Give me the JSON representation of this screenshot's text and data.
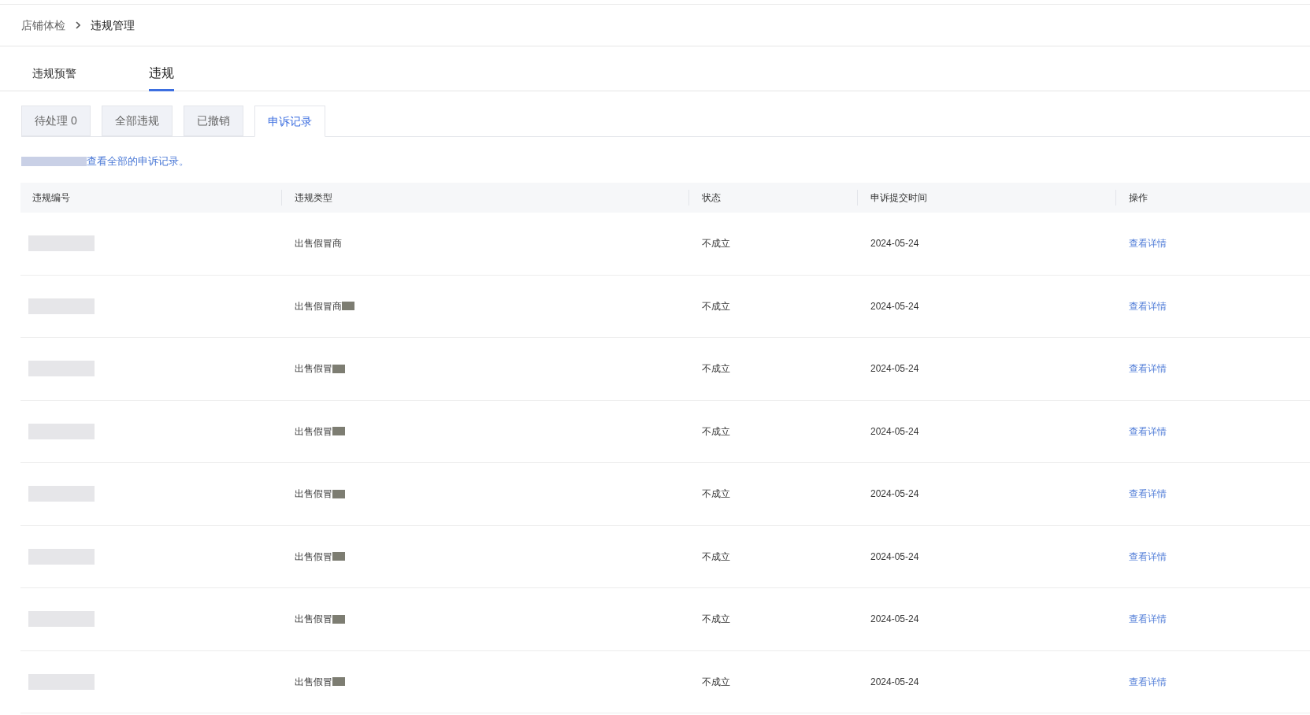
{
  "breadcrumb": [
    {
      "label": "店铺体检",
      "current": false
    },
    {
      "label": "违规管理",
      "current": true
    }
  ],
  "tabs": [
    {
      "label": "违规预警",
      "selected": false
    },
    {
      "label": "违规",
      "selected": true
    }
  ],
  "sub_tabs": [
    {
      "label": "待处理 0",
      "selected": false
    },
    {
      "label": "全部违规",
      "selected": false
    },
    {
      "label": "已撤销",
      "selected": false
    },
    {
      "label": "申诉记录",
      "selected": true
    }
  ],
  "notice": {
    "prefix_blurred": true,
    "text": "查看全部的申诉记录。"
  },
  "table": {
    "columns": [
      "违规编号",
      "违规类型",
      "状态",
      "申诉提交时间",
      "操作"
    ],
    "rows": [
      {
        "id_blurred": true,
        "type": "出售假冒商",
        "type_blurred": false,
        "status": "不成立",
        "date": "2024-05-24",
        "action": "查看详情"
      },
      {
        "id_blurred": true,
        "type": "出售假冒商",
        "type_blurred": true,
        "status": "不成立",
        "date": "2024-05-24",
        "action": "查看详情"
      },
      {
        "id_blurred": true,
        "type": "出售假冒",
        "type_blurred": true,
        "status": "不成立",
        "date": "2024-05-24",
        "action": "查看详情"
      },
      {
        "id_blurred": true,
        "type": "出售假冒",
        "type_blurred": true,
        "status": "不成立",
        "date": "2024-05-24",
        "action": "查看详情"
      },
      {
        "id_blurred": true,
        "type": "出售假冒",
        "type_blurred": true,
        "status": "不成立",
        "date": "2024-05-24",
        "action": "查看详情"
      },
      {
        "id_blurred": true,
        "type": "出售假冒",
        "type_blurred": true,
        "status": "不成立",
        "date": "2024-05-24",
        "action": "查看详情"
      },
      {
        "id_blurred": true,
        "type": "出售假冒",
        "type_blurred": true,
        "status": "不成立",
        "date": "2024-05-24",
        "action": "查看详情"
      },
      {
        "id_blurred": true,
        "type": "出售假冒",
        "type_blurred": true,
        "status": "不成立",
        "date": "2024-05-24",
        "action": "查看详情"
      }
    ]
  }
}
